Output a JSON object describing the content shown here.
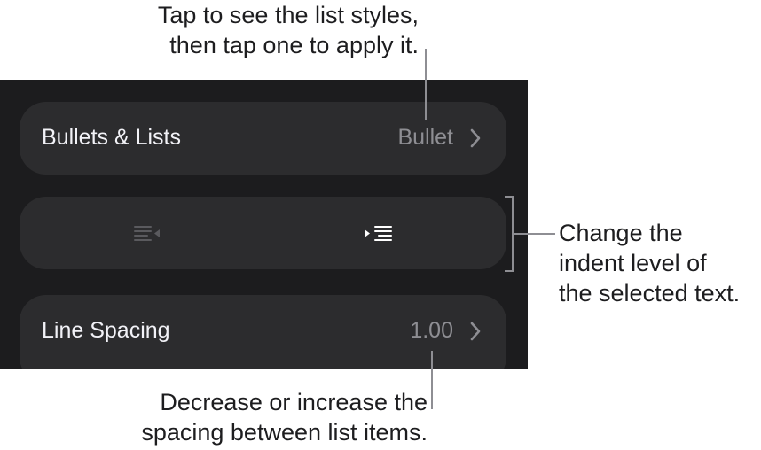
{
  "callouts": {
    "top": "Tap to see the list styles,\nthen tap one to apply it.",
    "right": "Change the\nindent level of\nthe selected text.",
    "bottom": "Decrease or increase the\nspacing between list items."
  },
  "rows": {
    "bullets": {
      "label": "Bullets & Lists",
      "value": "Bullet"
    },
    "spacing": {
      "label": "Line Spacing",
      "value": "1.00"
    }
  },
  "icons": {
    "chevron": "chevron-right-icon",
    "decrease_indent": "decrease-indent-icon",
    "increase_indent": "increase-indent-icon"
  },
  "colors": {
    "panel_bg": "#1c1c1e",
    "row_bg": "#2c2c2e",
    "label": "#f2f2f7",
    "value": "#8e8e93",
    "callout_text": "#1d1d1f",
    "callout_line": "#8e8e93"
  }
}
